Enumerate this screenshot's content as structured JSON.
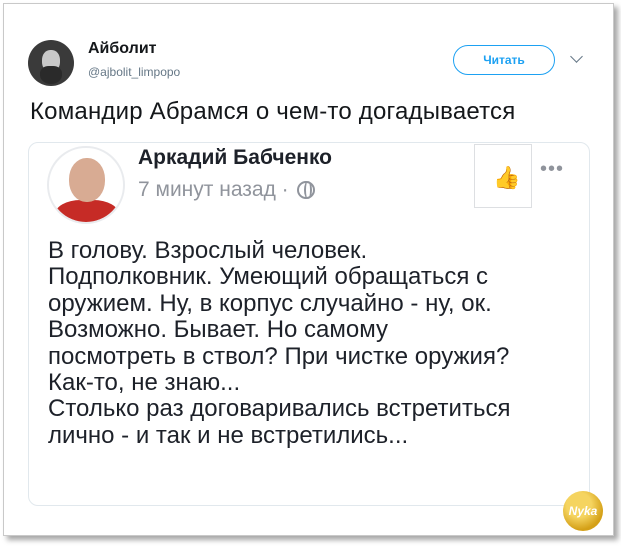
{
  "tweet": {
    "author_name": "Айболит",
    "author_handle": "@ajbolit_limpopo",
    "follow_label": "Читать",
    "text": "Командир Абрамся о чем-то догадывается",
    "avatar_icon": "user-avatar-icon"
  },
  "fb_post": {
    "author_name": "Аркадий Бабченко",
    "time": "7 минут назад ·",
    "privacy_icon": "globe-icon",
    "like_icon": "thumbs-up-icon",
    "more_icon": "more-dots-icon",
    "more_glyph": "•••",
    "like_glyph": "👍",
    "lines": [
      "В голову. Взрослый человек.",
      "Подполковник. Умеющий обращаться с",
      "оружием. Ну, в корпус случайно - ну, ок.",
      "Возможно. Бывает. Но самому",
      "посмотреть в ствол? При чистке оружия?",
      "Как-то, не знаю...",
      "Столько раз договаривались встретиться",
      "лично - и так и не встретились..."
    ]
  },
  "watermark": {
    "text": "Nyka"
  },
  "colors": {
    "twitter_blue": "#1da1f2",
    "fb_gray": "#90949c",
    "text_dark": "#1d2129"
  }
}
